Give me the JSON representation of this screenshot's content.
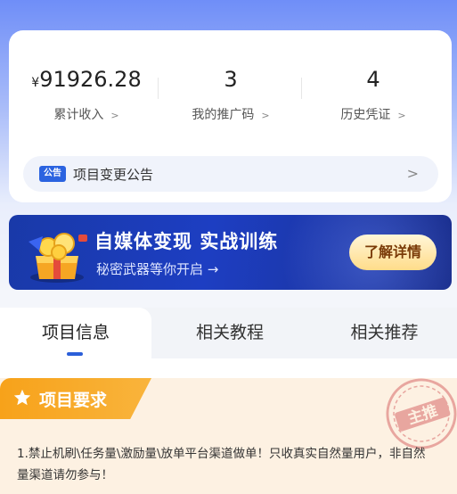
{
  "stats": {
    "income": {
      "currency": "¥",
      "value": "91926.28",
      "label": "累计收入"
    },
    "promo_codes": {
      "value": "3",
      "label": "我的推广码"
    },
    "history": {
      "value": "4",
      "label": "历史凭证"
    }
  },
  "notice": {
    "tag": "公告",
    "text": "项目变更公告"
  },
  "banner": {
    "title_part1": "自媒体变现",
    "title_part2": "实战训练",
    "subtitle": "秘密武器等你开启 →",
    "button": "了解详情"
  },
  "tabs": [
    {
      "label": "项目信息",
      "active": true
    },
    {
      "label": "相关教程",
      "active": false
    },
    {
      "label": "相关推荐",
      "active": false
    }
  ],
  "requirements": {
    "title": "项目要求",
    "text": "1.禁止机刷\\任务量\\激励量\\放单平台渠道做单！只收真实自然量用户，非自然量渠道请勿参与！",
    "stamp": "主推"
  },
  "colors": {
    "accent": "#2b5fd9",
    "orange": "#f7a21a",
    "banner_bg": "#1d3ec2"
  }
}
